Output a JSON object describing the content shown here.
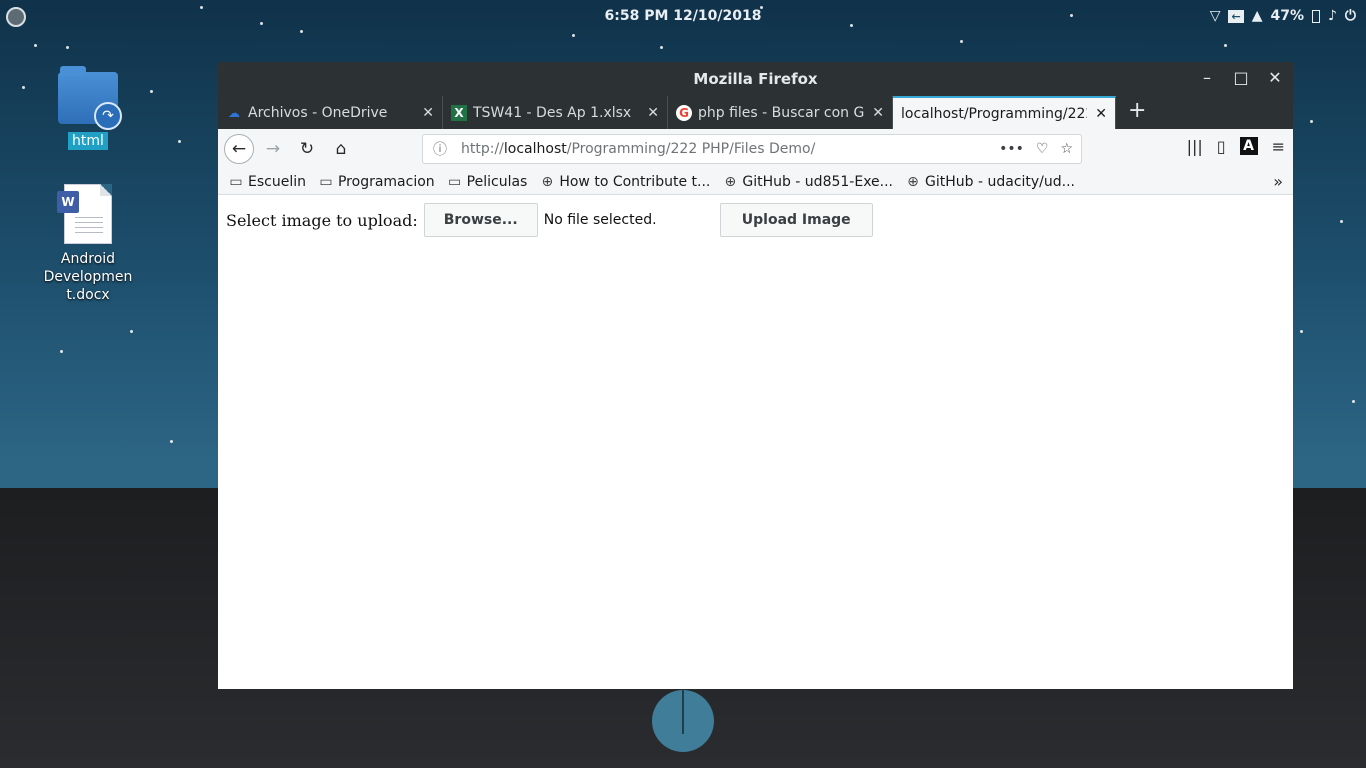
{
  "desktop": {
    "panel": {
      "clock": "6:58 PM  12/10/2018",
      "battery_percent": "47%",
      "tray_icons": [
        "wifi-icon",
        "screen-share-icon",
        "notification-bell-icon",
        "battery-icon",
        "volume-icon",
        "power-icon"
      ]
    },
    "icons": [
      {
        "label": "html",
        "type": "folder-link"
      },
      {
        "label": "Android\nDevelopmen\nt.docx",
        "type": "word-document"
      }
    ]
  },
  "window": {
    "title": "Mozilla Firefox",
    "tabs": [
      {
        "label": "Archivos - OneDrive",
        "icon": "onedrive-icon",
        "active": false
      },
      {
        "label": "TSW41 - Des Ap 1.xlsx",
        "icon": "excel-icon",
        "active": false
      },
      {
        "label": "php files - Buscar con Google",
        "icon": "google-icon",
        "active": false
      },
      {
        "label": "localhost/Programming/222",
        "icon": "",
        "active": true
      }
    ],
    "address": {
      "prefix": "http://",
      "host": "localhost",
      "path": "/Programming/222 PHP/Files Demo/"
    },
    "bookmarks": [
      {
        "label": "Escuelin",
        "icon": "folder-icon"
      },
      {
        "label": "Programacion",
        "icon": "folder-icon"
      },
      {
        "label": "Peliculas",
        "icon": "folder-icon"
      },
      {
        "label": "How to Contribute t...",
        "icon": "globe-icon"
      },
      {
        "label": "GitHub - ud851-Exe...",
        "icon": "globe-icon"
      },
      {
        "label": "GitHub - udacity/ud...",
        "icon": "globe-icon"
      }
    ]
  },
  "page": {
    "upload_label": "Select image to upload:",
    "browse_button": "Browse...",
    "file_status": "No file selected.",
    "upload_button": "Upload Image"
  }
}
